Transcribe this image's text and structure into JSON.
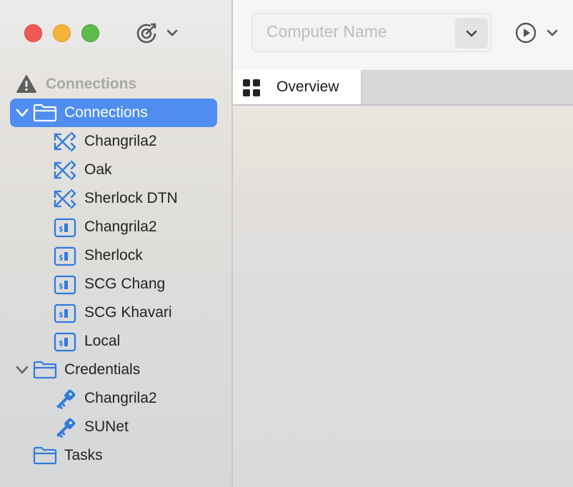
{
  "window": {
    "traffic_lights": [
      "close",
      "minimize",
      "zoom"
    ],
    "colors": {
      "close": "#ee5a53",
      "minimize": "#f4b43a",
      "zoom": "#5ebd4a",
      "accent": "#4f8ef0",
      "icon_blue": "#2f7be0"
    }
  },
  "sidebar": {
    "section_title": "Connections",
    "groups": [
      {
        "label": "Connections",
        "expanded": true,
        "selected": true,
        "items": [
          {
            "label": "Changrila2",
            "icon": "transfer-icon"
          },
          {
            "label": "Oak",
            "icon": "transfer-icon"
          },
          {
            "label": "Sherlock DTN",
            "icon": "transfer-icon"
          },
          {
            "label": "Changrila2",
            "icon": "terminal-icon"
          },
          {
            "label": "Sherlock",
            "icon": "terminal-icon"
          },
          {
            "label": "SCG Chang",
            "icon": "terminal-icon"
          },
          {
            "label": "SCG Khavari",
            "icon": "terminal-icon"
          },
          {
            "label": "Local",
            "icon": "terminal-icon"
          }
        ]
      },
      {
        "label": "Credentials",
        "expanded": true,
        "items": [
          {
            "label": "Changrila2",
            "icon": "key-icon"
          },
          {
            "label": "SUNet",
            "icon": "key-icon"
          }
        ]
      },
      {
        "label": "Tasks",
        "expanded": false,
        "items": []
      }
    ]
  },
  "toolbar": {
    "computer_name_placeholder": "Computer Name"
  },
  "tabs": [
    {
      "label": "Overview",
      "icon": "grid-icon",
      "active": true
    }
  ]
}
